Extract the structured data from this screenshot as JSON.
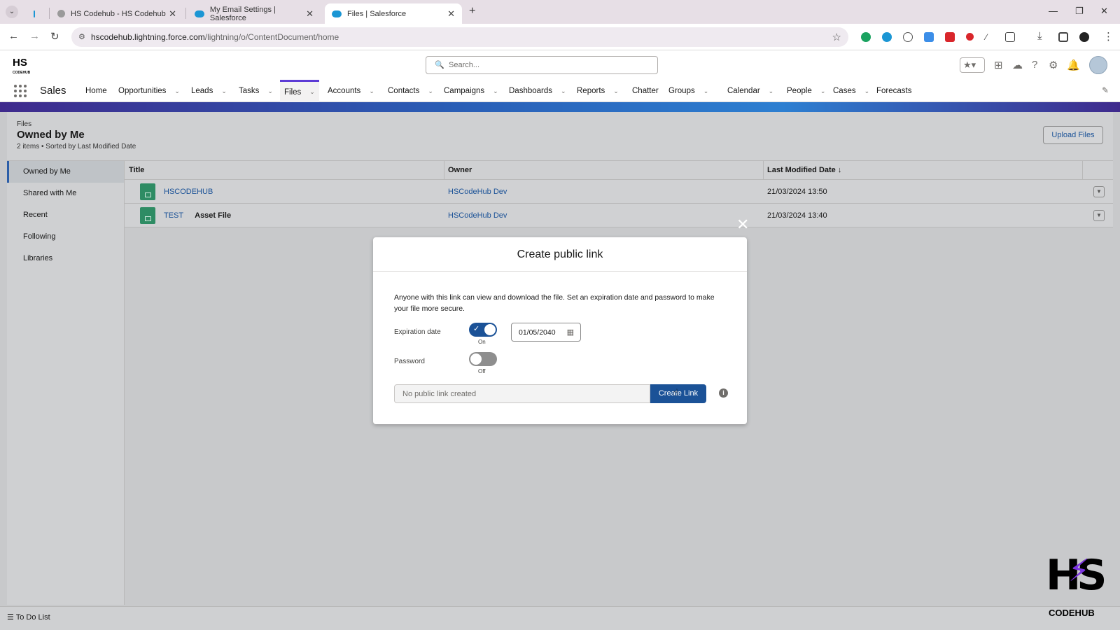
{
  "browser": {
    "tabs": [
      {
        "title": "HS Codehub - HS Codehub",
        "active": false
      },
      {
        "title": "My Email Settings | Salesforce",
        "active": false
      },
      {
        "title": "Files | Salesforce",
        "active": true
      }
    ],
    "url_host": "hscodehub.lightning.force.com",
    "url_path": "/lightning/o/ContentDocument/home"
  },
  "sf": {
    "search_placeholder": "Search...",
    "app_name": "Sales",
    "nav": [
      {
        "label": "Home",
        "dropdown": false
      },
      {
        "label": "Opportunities",
        "dropdown": true
      },
      {
        "label": "Leads",
        "dropdown": true
      },
      {
        "label": "Tasks",
        "dropdown": true
      },
      {
        "label": "Files",
        "dropdown": true,
        "active": true
      },
      {
        "label": "Accounts",
        "dropdown": true
      },
      {
        "label": "Contacts",
        "dropdown": true
      },
      {
        "label": "Campaigns",
        "dropdown": true
      },
      {
        "label": "Dashboards",
        "dropdown": true
      },
      {
        "label": "Reports",
        "dropdown": true
      },
      {
        "label": "Chatter",
        "dropdown": false
      },
      {
        "label": "Groups",
        "dropdown": true
      },
      {
        "label": "Calendar",
        "dropdown": true
      },
      {
        "label": "People",
        "dropdown": true
      },
      {
        "label": "Cases",
        "dropdown": true
      },
      {
        "label": "Forecasts",
        "dropdown": false
      }
    ]
  },
  "page": {
    "object_label": "Files",
    "list_title": "Owned by Me",
    "list_meta": "2 items • Sorted by Last Modified Date",
    "upload_label": "Upload Files",
    "sidebar": [
      "Owned by Me",
      "Shared with Me",
      "Recent",
      "Following",
      "Libraries"
    ],
    "columns": {
      "title": "Title",
      "owner": "Owner",
      "modified": "Last Modified Date"
    },
    "sort_arrow": "↓",
    "rows": [
      {
        "title": "HSCODEHUB",
        "tag": "",
        "owner": "HSCodeHub Dev",
        "modified": "21/03/2024 13:50"
      },
      {
        "title": "TEST",
        "tag": "Asset File",
        "owner": "HSCodeHub Dev",
        "modified": "21/03/2024 13:40"
      }
    ]
  },
  "footer": {
    "todo": "To Do List"
  },
  "brand": {
    "letters": "HS",
    "sub": "CODEHUB"
  },
  "modal": {
    "title": "Create public link",
    "description": "Anyone with this link can view and download the file. Set an expiration date and password to make your file more secure.",
    "expiration_label": "Expiration date",
    "expiration_state": "On",
    "expiration_date": "01/05/2040",
    "password_label": "Password",
    "password_state": "Off",
    "link_placeholder": "No public link created",
    "create_label": "Create Link"
  }
}
